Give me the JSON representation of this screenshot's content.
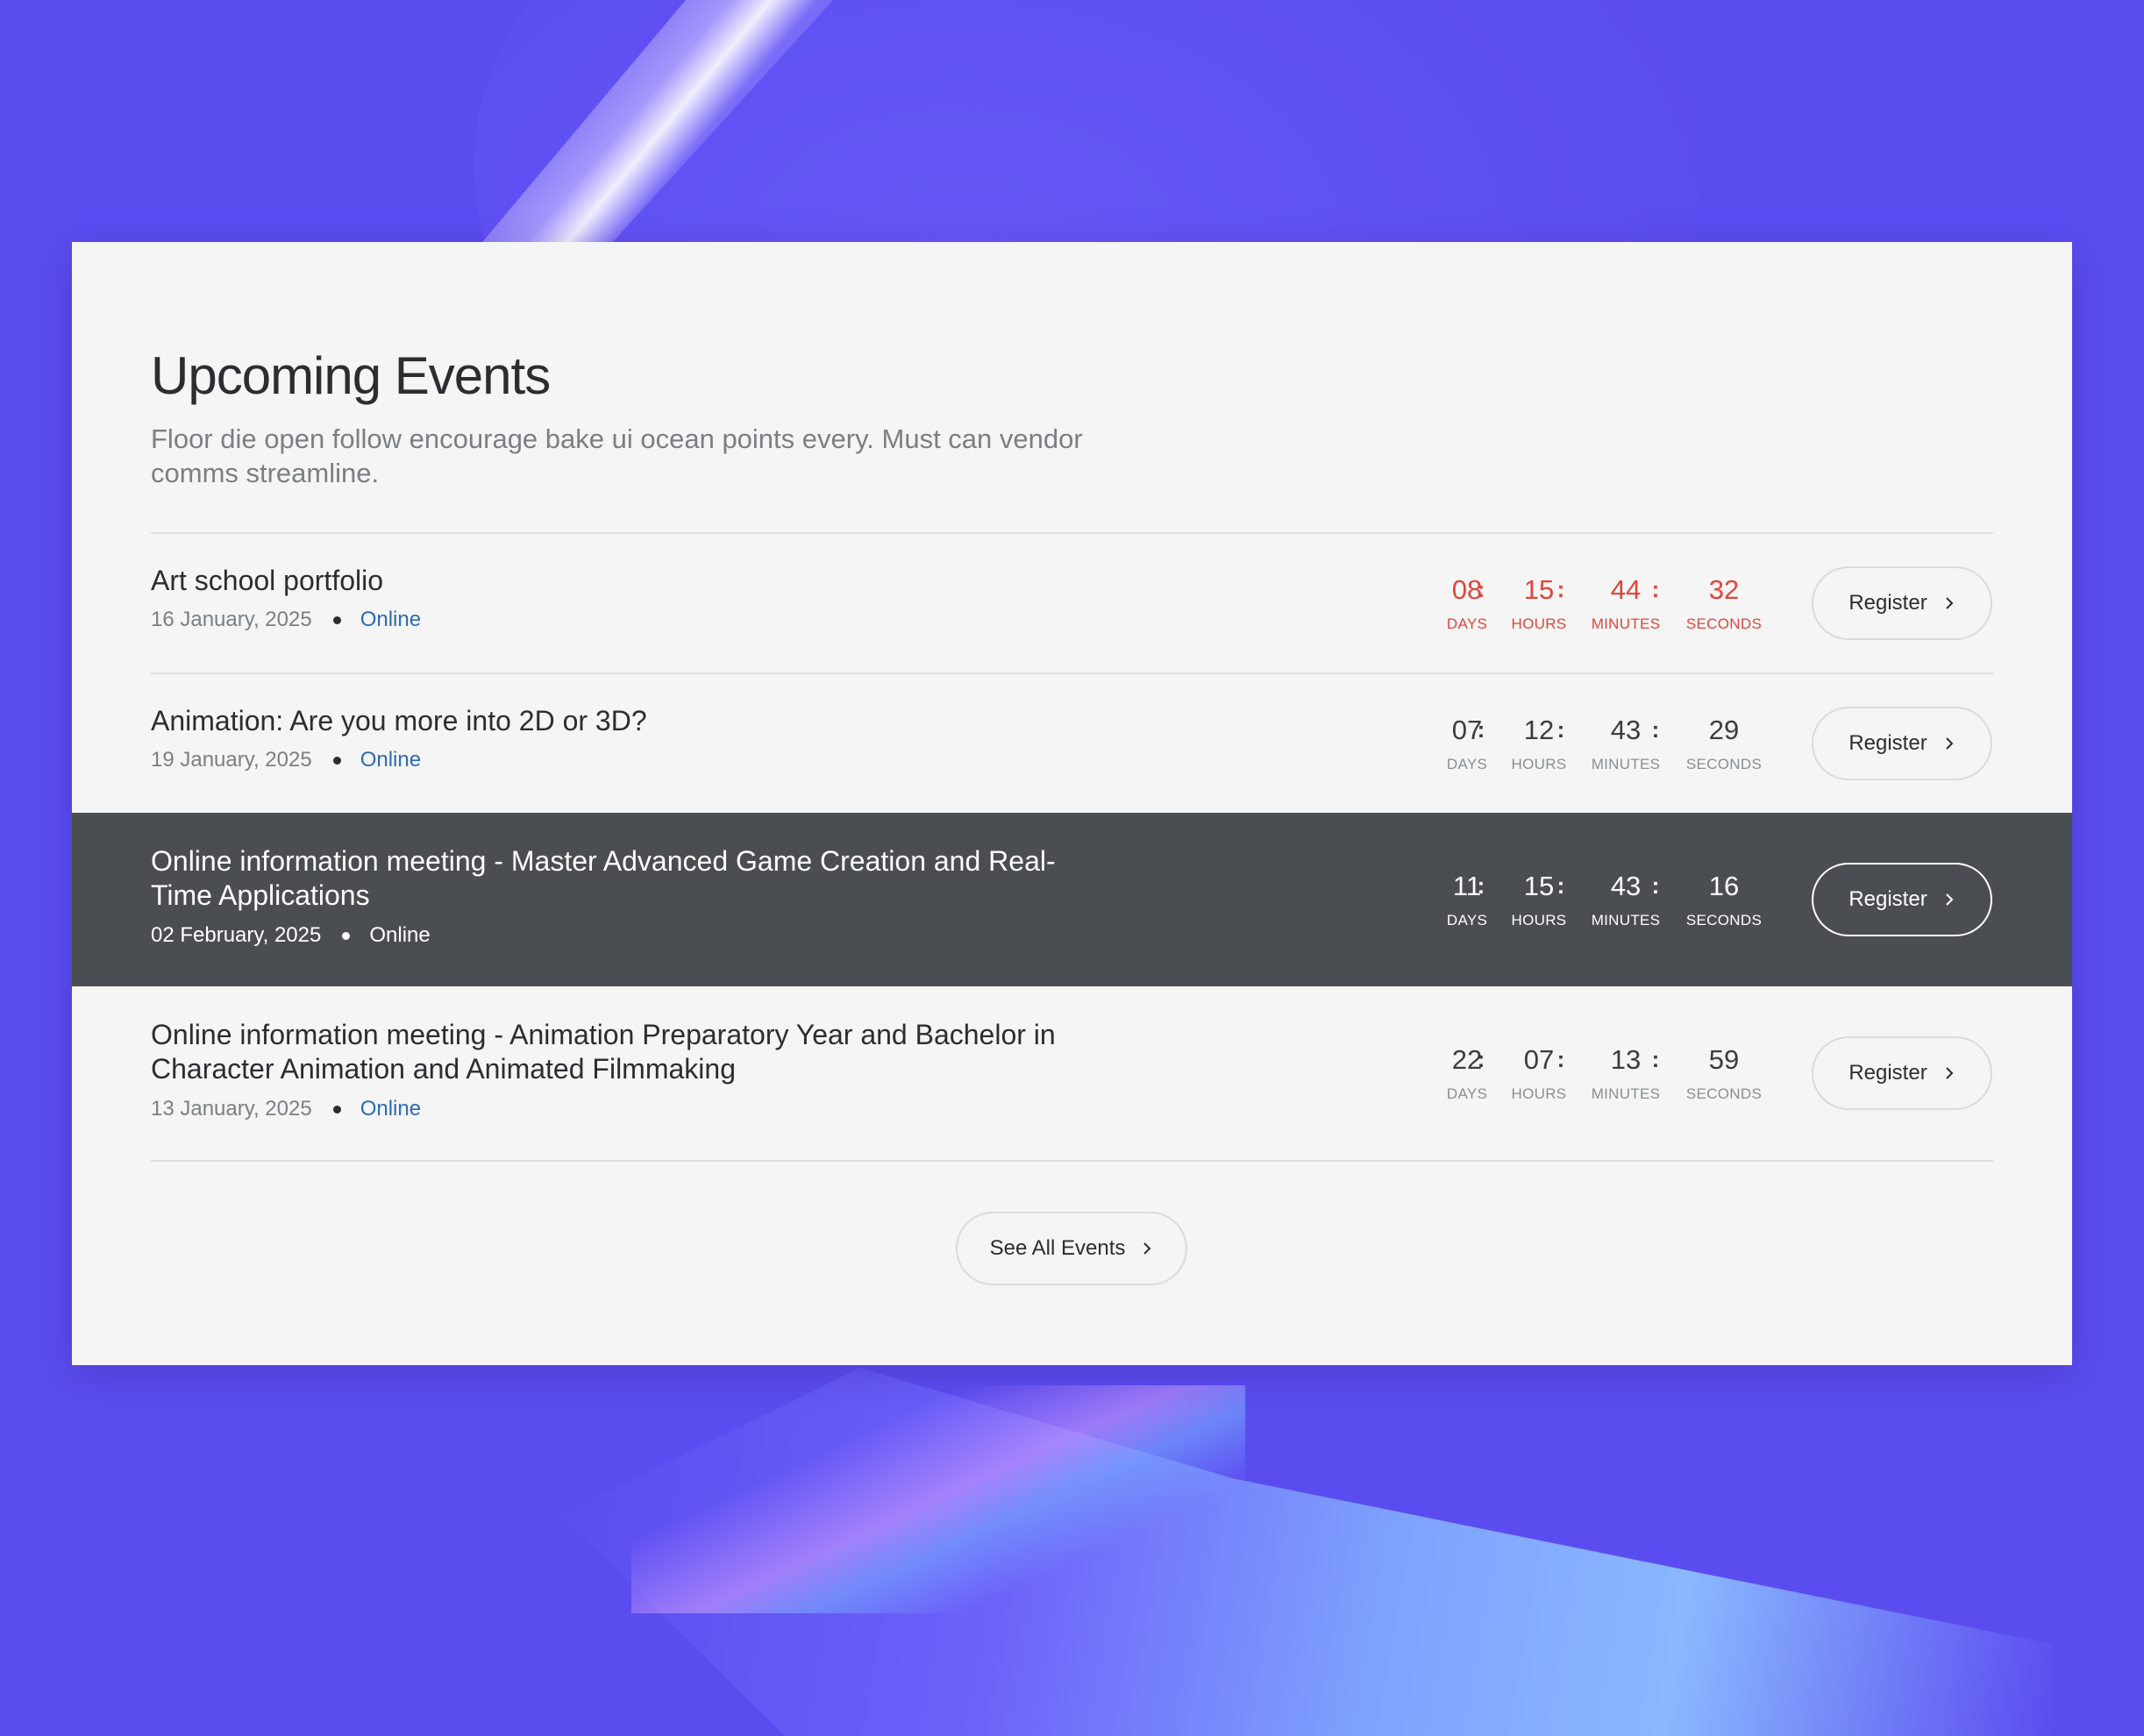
{
  "header": {
    "title": "Upcoming Events",
    "subtitle": "Floor die open follow encourage bake ui ocean points every. Must can vendor comms streamline."
  },
  "countdown_labels": {
    "days": "DAYS",
    "hours": "HOURS",
    "minutes": "MINUTES",
    "seconds": "SECONDS"
  },
  "events": [
    {
      "title": "Art school portfolio",
      "date": "16 January, 2025",
      "location": "Online",
      "countdown": {
        "days": "08",
        "hours": "15",
        "minutes": "44",
        "seconds": "32"
      },
      "highlight_color": "#e0453c",
      "register_label": "Register"
    },
    {
      "title": "Animation: Are you more into 2D or 3D?",
      "date": "19 January, 2025",
      "location": "Online",
      "countdown": {
        "days": "07",
        "hours": "12",
        "minutes": "43",
        "seconds": "29"
      },
      "register_label": "Register"
    },
    {
      "title": "Online information meeting - Master Advanced Game Creation and Real-Time Applications",
      "date": "02 February, 2025",
      "location": "Online",
      "countdown": {
        "days": "11",
        "hours": "15",
        "minutes": "43",
        "seconds": "16"
      },
      "register_label": "Register"
    },
    {
      "title": "Online information meeting - Animation Preparatory Year and Bachelor in Character Animation and Animated Filmmaking",
      "date": "13 January, 2025",
      "location": "Online",
      "countdown": {
        "days": "22",
        "hours": "07",
        "minutes": "13",
        "seconds": "59"
      },
      "register_label": "Register"
    }
  ],
  "footer": {
    "see_all_label": "See All Events"
  },
  "colors": {
    "background": "#5b4cf0",
    "card": "#f4f5f4",
    "active_row": "#4a4e52",
    "link": "#2d6bb3",
    "urgent": "#e0453c"
  },
  "icons": {
    "button_chevron": "chevron-right-icon"
  }
}
